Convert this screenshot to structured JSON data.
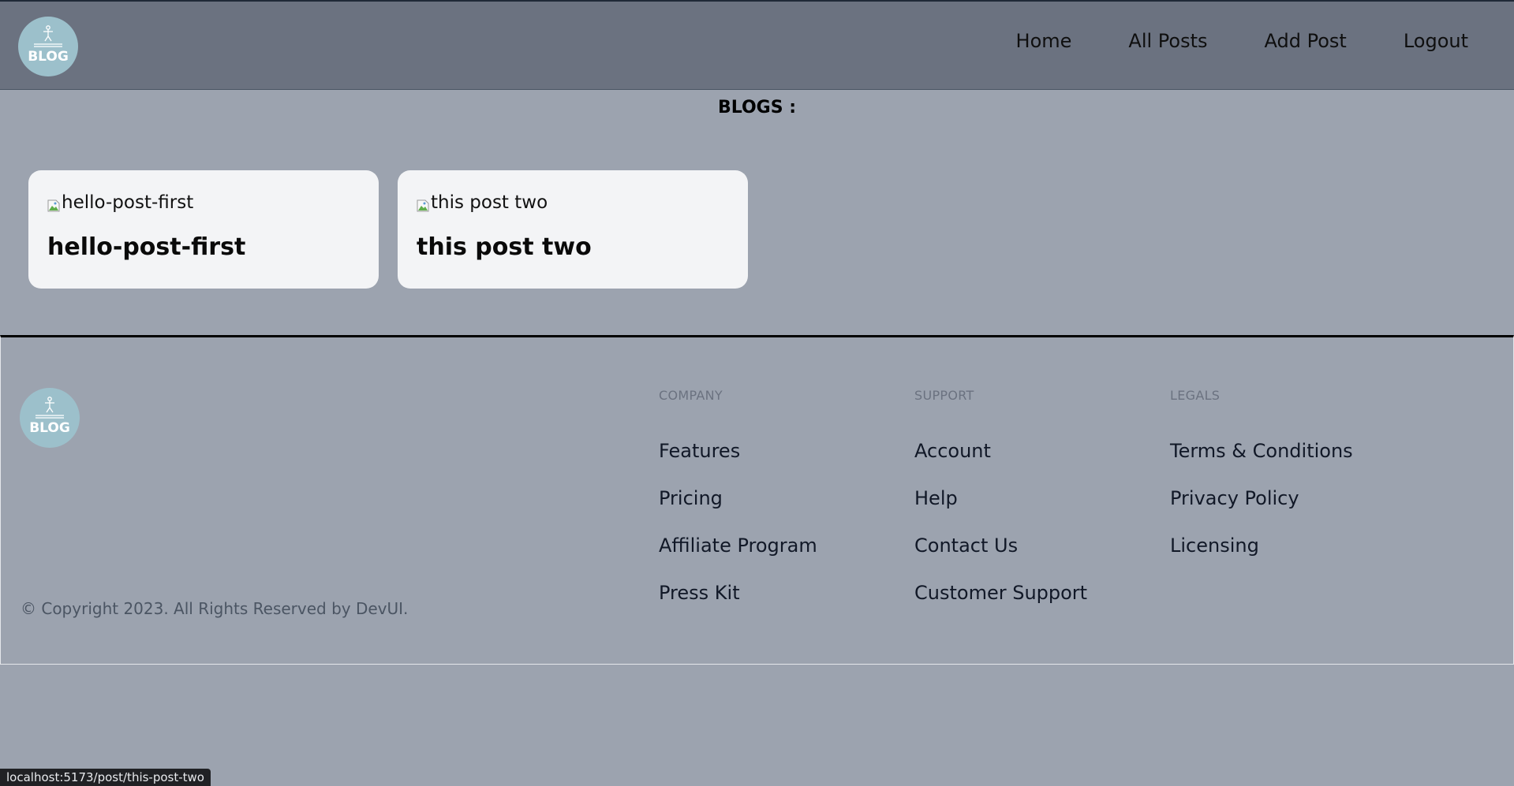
{
  "header": {
    "logo_text": "BLOG",
    "nav": [
      {
        "label": "Home"
      },
      {
        "label": "All Posts"
      },
      {
        "label": "Add Post"
      },
      {
        "label": "Logout"
      }
    ]
  },
  "main": {
    "heading": "BLOGS :",
    "posts": [
      {
        "image_alt": "hello-post-first",
        "title": "hello-post-first"
      },
      {
        "image_alt": "this post two",
        "title": "this post two"
      }
    ]
  },
  "footer": {
    "logo_text": "BLOG",
    "copyright": "© Copyright 2023. All Rights Reserved by DevUI.",
    "columns": [
      {
        "heading": "COMPANY",
        "links": [
          "Features",
          "Pricing",
          "Affiliate Program",
          "Press Kit"
        ]
      },
      {
        "heading": "SUPPORT",
        "links": [
          "Account",
          "Help",
          "Contact Us",
          "Customer Support"
        ]
      },
      {
        "heading": "LEGALS",
        "links": [
          "Terms & Conditions",
          "Privacy Policy",
          "Licensing"
        ]
      }
    ]
  },
  "status_bar": {
    "url": "localhost:5173/post/this-post-two"
  },
  "colors": {
    "header_bg": "#6b7280",
    "page_bg": "#9ca3af",
    "card_bg": "#f3f4f6",
    "logo_bg": "#9cc0cb"
  }
}
